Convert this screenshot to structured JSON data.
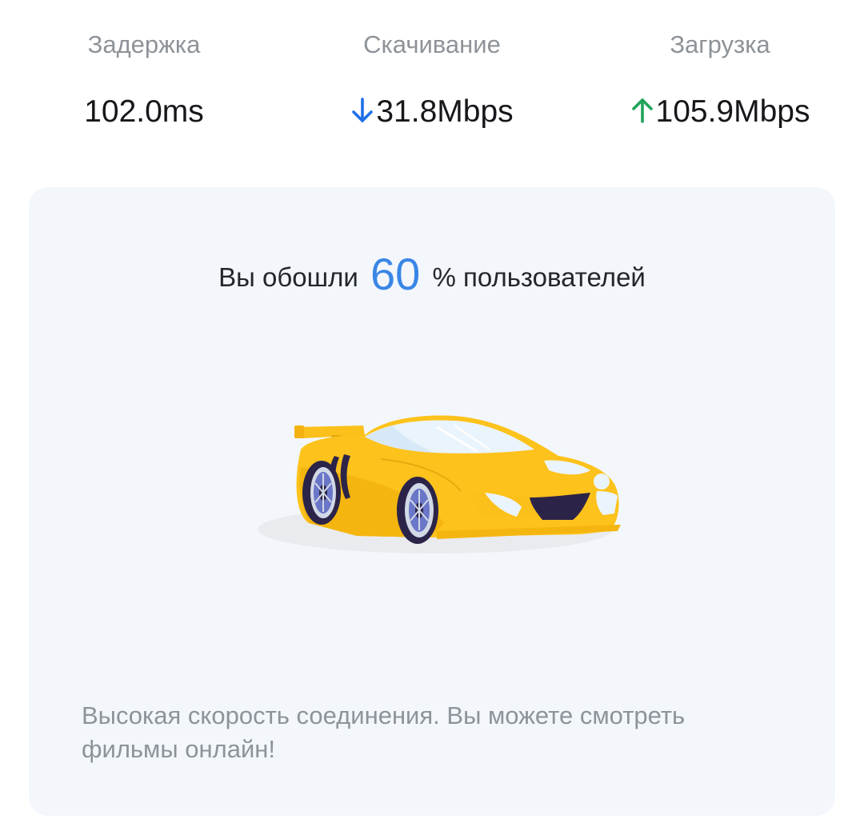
{
  "stats": {
    "latency": {
      "label": "Задержка",
      "value": "102.0ms"
    },
    "download": {
      "label": "Скачивание",
      "value": "31.8Mbps",
      "icon": "arrow-down-icon",
      "color": "#1f6fe8"
    },
    "upload": {
      "label": "Загрузка",
      "value": "105.9Mbps",
      "icon": "arrow-up-icon",
      "color": "#21a45a"
    }
  },
  "result": {
    "prefix": "Вы обошли",
    "percent": "60",
    "suffix": "% пользователей",
    "illustration": "sports-car-illustration",
    "message": "Высокая скорость соединения. Вы можете смотреть фильмы онлайн!"
  },
  "colors": {
    "accent": "#3a86e6",
    "card_background": "#f3f7fc",
    "car_body": "#fdc21b"
  }
}
